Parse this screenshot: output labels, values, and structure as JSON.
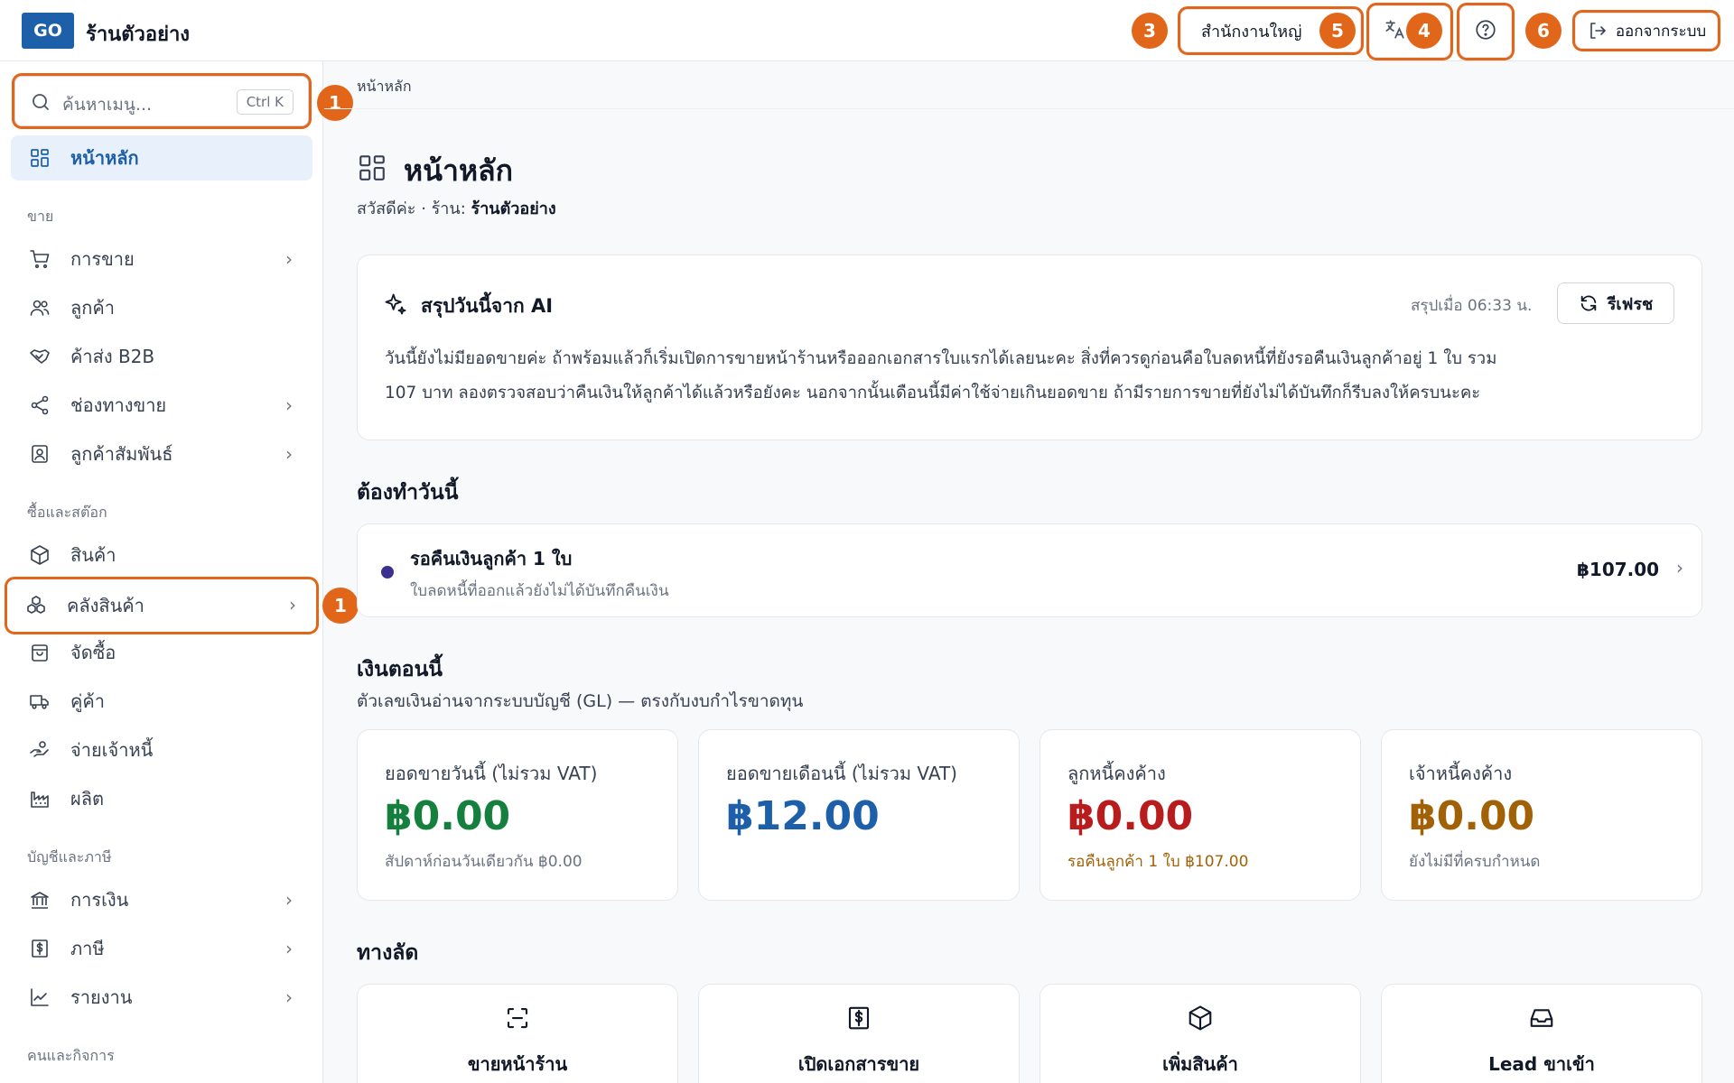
{
  "topbar": {
    "logo": "GO",
    "shop_name": "ร้านตัวอย่าง",
    "branch": "สำนักงานใหญ่",
    "translate_icon": "translate-icon",
    "help_icon": "help-icon",
    "logout_label": "ออกจากระบบ"
  },
  "annotations": [
    "1",
    "1",
    "3",
    "4",
    "5",
    "6"
  ],
  "sidebar": {
    "search_placeholder": "ค้นหาเมนู...",
    "search_shortcut": "Ctrl K",
    "home_label": "หน้าหลัก",
    "sections": {
      "sales": "ขาย",
      "purchase": "ซื้อและสต๊อก",
      "accounting": "บัญชีและภาษี",
      "people": "คนและกิจการ"
    },
    "items": {
      "sales": "การขาย",
      "customers": "ลูกค้า",
      "b2b": "ค้าส่ง B2B",
      "channels": "ช่องทางขาย",
      "crm": "ลูกค้าสัมพันธ์",
      "products": "สินค้า",
      "warehouse": "คลังสินค้า",
      "procurement": "จัดซื้อ",
      "partners": "คู่ค้า",
      "payables": "จ่ายเจ้าหนี้",
      "production": "ผลิต",
      "finance": "การเงิน",
      "tax": "ภาษี",
      "reports": "รายงาน"
    }
  },
  "main": {
    "breadcrumb": "หน้าหลัก",
    "title": "หน้าหลัก",
    "greeting_prefix": "สวัสดีค่ะ · ร้าน:",
    "greeting_shop": "ร้านตัวอย่าง",
    "ai": {
      "title": "สรุปวันนี้จาก AI",
      "summarized_at": "สรุปเมื่อ 06:33 น.",
      "refresh_label": "รีเฟรช",
      "line1": "วันนี้ยังไม่มียอดขายค่ะ ถ้าพร้อมแล้วก็เริ่มเปิดการขายหน้าร้านหรือออกเอกสารใบแรกได้เลยนะคะ สิ่งที่ควรดูก่อนคือใบลดหนี้ที่ยังรอคืนเงินลูกค้าอยู่ 1 ใบ รวม",
      "line2": "107 บาท ลองตรวจสอบว่าคืนเงินให้ลูกค้าได้แล้วหรือยังคะ นอกจากนั้นเดือนนี้มีค่าใช้จ่ายเกินยอดขาย ถ้ามีรายการขายที่ยังไม่ได้บันทึกก็รีบลงให้ครบนะคะ"
    },
    "todo": {
      "heading": "ต้องทำวันนี้",
      "item_title": "รอคืนเงินลูกค้า 1 ใบ",
      "item_sub": "ใบลดหนี้ที่ออกแล้วยังไม่ได้บันทึกคืนเงิน",
      "item_amount": "฿107.00"
    },
    "money": {
      "heading": "เงินตอนนี้",
      "subtitle": "ตัวเลขเงินอ่านจากระบบบัญชี (GL) — ตรงกับงบกำไรขาดทุน",
      "kpis": [
        {
          "label": "ยอดขายวันนี้ (ไม่รวม VAT)",
          "value": "฿0.00",
          "note": "สัปดาห์ก่อนวันเดียวกัน ฿0.00",
          "color": "#15803d",
          "note_color": "#6b7280"
        },
        {
          "label": "ยอดขายเดือนนี้ (ไม่รวม VAT)",
          "value": "฿12.00",
          "note": "",
          "color": "#1d5fa8",
          "note_color": "#6b7280"
        },
        {
          "label": "ลูกหนี้คงค้าง",
          "value": "฿0.00",
          "note": "รอคืนลูกค้า 1 ใบ ฿107.00",
          "color": "#b91c1c",
          "note_color": "#a16207"
        },
        {
          "label": "เจ้าหนี้คงค้าง",
          "value": "฿0.00",
          "note": "ยังไม่มีที่ครบกำหนด",
          "color": "#a16207",
          "note_color": "#6b7280"
        }
      ]
    },
    "shortcuts": {
      "heading": "ทางลัด",
      "items": [
        {
          "label": "ขายหน้าร้าน",
          "icon": "scan-icon"
        },
        {
          "label": "เปิดเอกสารขาย",
          "icon": "receipt-icon"
        },
        {
          "label": "เพิ่มสินค้า",
          "icon": "box-icon"
        },
        {
          "label": "Lead ขาเข้า",
          "icon": "inbox-icon"
        }
      ]
    }
  },
  "colors": {
    "brand": "#1d5fa8",
    "highlight": "#e2661a",
    "todo_dot": "#3b2f8f"
  }
}
